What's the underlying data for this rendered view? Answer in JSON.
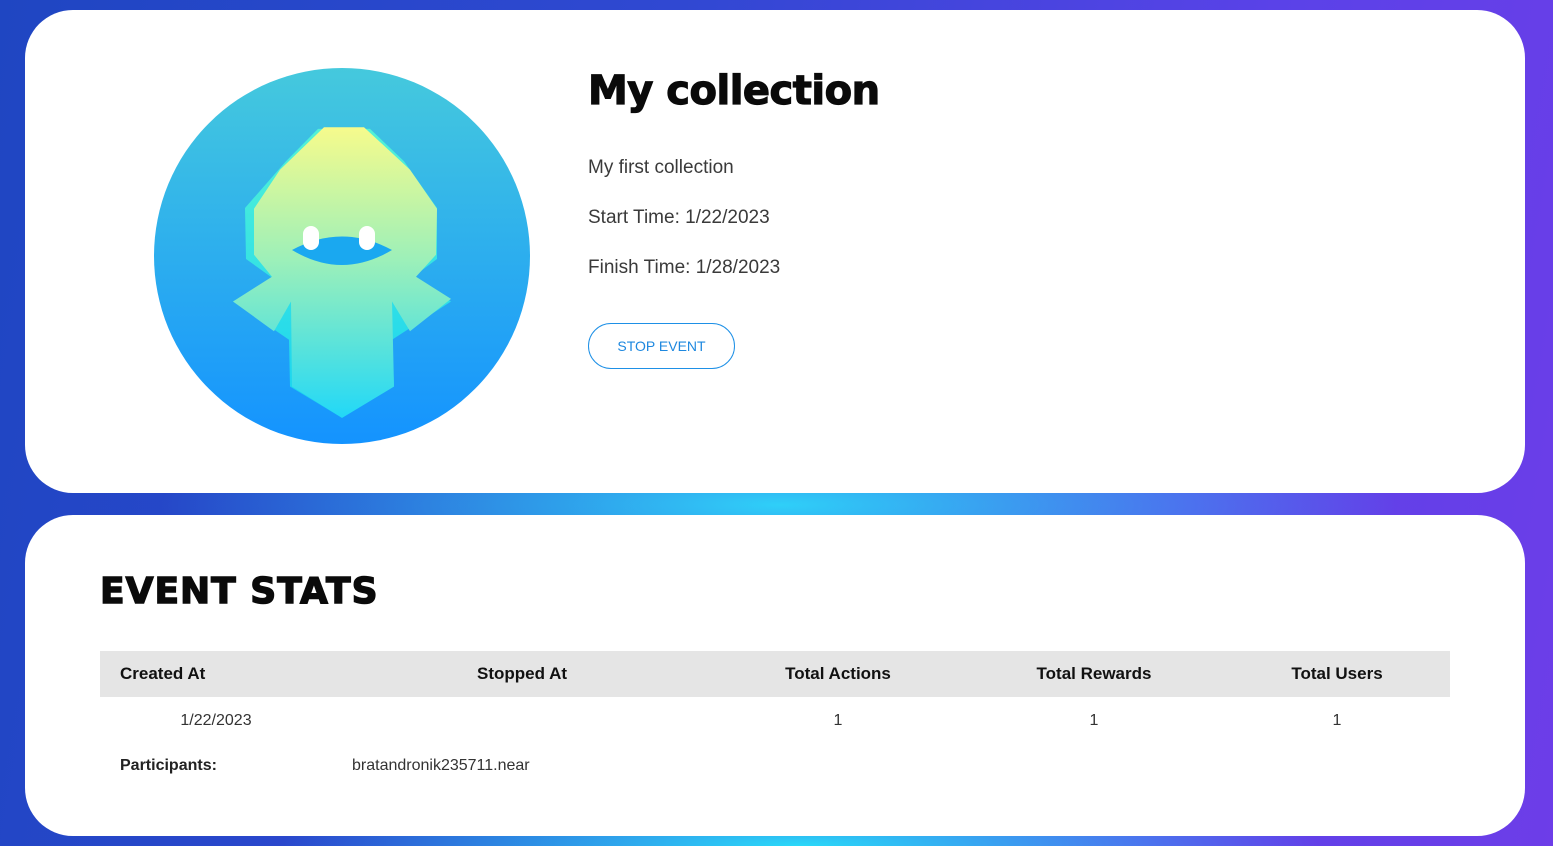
{
  "collection": {
    "title": "My collection",
    "description": "My first collection",
    "start_time": "Start Time: 1/22/2023",
    "finish_time": "Finish Time: 1/28/2023",
    "stop_button_label": "STOP EVENT",
    "avatar_icon": "hooded-ghost-icon"
  },
  "stats": {
    "title": "EVENT STATS",
    "columns": [
      "Created At",
      "Stopped At",
      "Total Actions",
      "Total Rewards",
      "Total Users"
    ],
    "rows": [
      {
        "created_at": "1/22/2023",
        "stopped_at": "",
        "total_actions": "1",
        "total_rewards": "1",
        "total_users": "1"
      }
    ],
    "participants_label": "Participants:",
    "participants": [
      "bratandronik235711.near"
    ]
  },
  "colors": {
    "accent": "#1e88df",
    "table_header_bg": "#e5e5e5",
    "background_start": "#1f46c2",
    "background_end": "#6d3de8",
    "highlight": "#2ed7fa"
  }
}
